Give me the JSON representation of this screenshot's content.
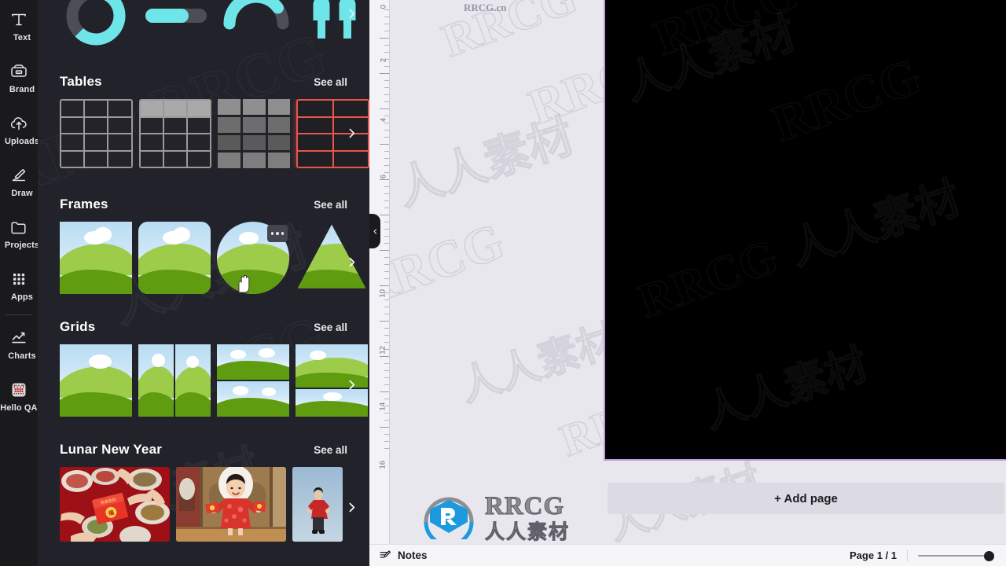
{
  "sidebar": {
    "items": [
      {
        "label": "Text",
        "icon": "text-icon"
      },
      {
        "label": "Brand",
        "icon": "brand-icon"
      },
      {
        "label": "Uploads",
        "icon": "uploads-icon"
      },
      {
        "label": "Draw",
        "icon": "draw-icon"
      },
      {
        "label": "Projects",
        "icon": "projects-icon"
      },
      {
        "label": "Apps",
        "icon": "apps-icon"
      },
      {
        "label": "Charts",
        "icon": "charts-icon"
      },
      {
        "label": "Hello QArt",
        "icon": "qr-code-icon"
      }
    ]
  },
  "panel": {
    "charts_row": {
      "items": [
        {
          "name": "progress-ring-chart"
        },
        {
          "name": "progress-bar-chart"
        },
        {
          "name": "gauge-chart"
        },
        {
          "name": "pictogram-chart"
        }
      ],
      "next_label": "›"
    },
    "sections": [
      {
        "title": "Tables",
        "see_all": "See all",
        "items": [
          {
            "name": "table-plain"
          },
          {
            "name": "table-header"
          },
          {
            "name": "table-filled"
          },
          {
            "name": "table-red-outline"
          }
        ]
      },
      {
        "title": "Frames",
        "see_all": "See all",
        "items": [
          {
            "name": "frame-square"
          },
          {
            "name": "frame-rounded-square"
          },
          {
            "name": "frame-circle"
          },
          {
            "name": "frame-triangle"
          }
        ]
      },
      {
        "title": "Grids",
        "see_all": "See all",
        "items": [
          {
            "name": "grid-single"
          },
          {
            "name": "grid-two-column"
          },
          {
            "name": "grid-two-row"
          },
          {
            "name": "grid-partial"
          }
        ]
      },
      {
        "title": "Lunar New Year",
        "see_all": "See all",
        "items": [
          {
            "name": "lny-photo-red-envelope-table"
          },
          {
            "name": "lny-photo-child-red-dress"
          },
          {
            "name": "lny-photo-person-red-coat"
          }
        ]
      }
    ]
  },
  "canvas": {
    "ruler_ticks": [
      "0",
      "2",
      "4",
      "6",
      "10",
      "12",
      "14",
      "16"
    ],
    "collapse_icon": "chevron-left-icon",
    "page_border_color": "#b79ae0",
    "page_background": "#000000",
    "add_page_label": "+ Add page",
    "expand_icon": "chevron-up-icon"
  },
  "bottom_bar": {
    "notes_label": "Notes",
    "notes_icon": "notes-pencil-icon",
    "page_count": "Page 1 / 1",
    "zoom_slider": {
      "value": 100
    }
  },
  "watermarks": {
    "brand": "RRCG",
    "brand_cn": "人人素材",
    "site": "RRCG.cn"
  },
  "colors": {
    "rail_bg": "#1a1a1c",
    "panel_bg": "#22232a",
    "canvas_bg": "#e8e7ee",
    "accent_cyan": "#6ee5e8",
    "accent_red": "#e8554e",
    "selection_purple": "#b79ae0"
  }
}
